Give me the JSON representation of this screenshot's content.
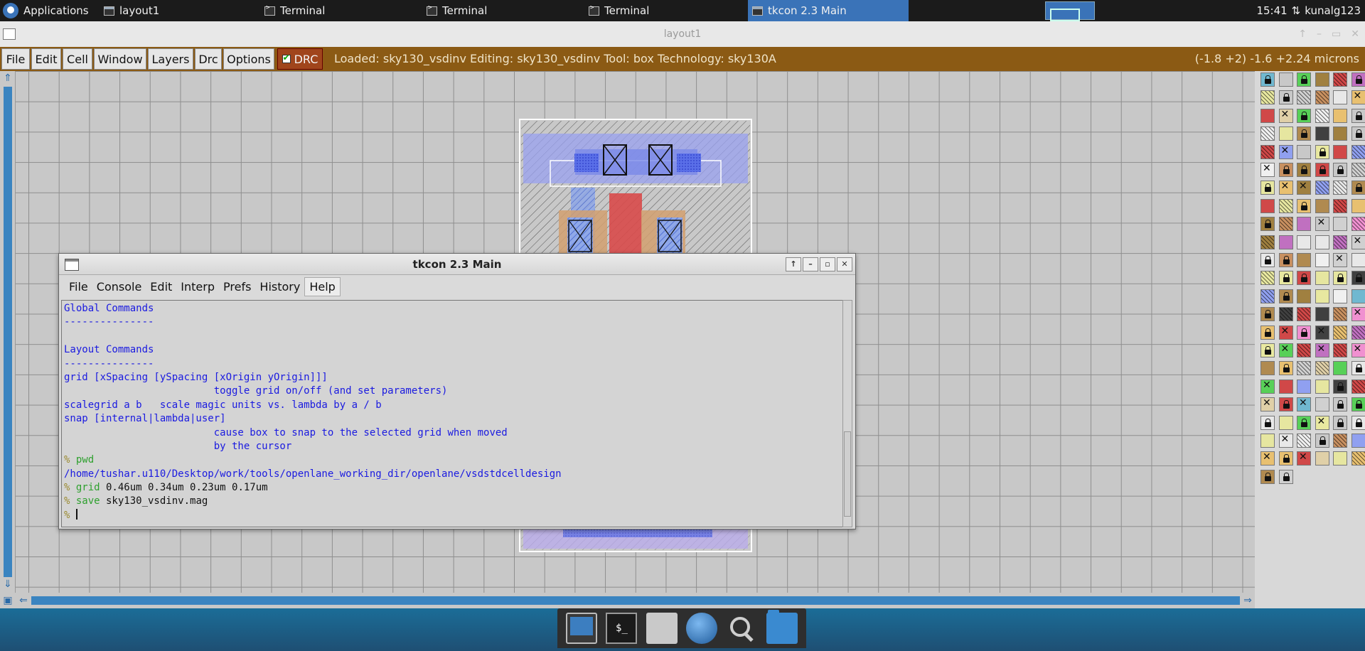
{
  "taskbar": {
    "applications": "Applications",
    "tasks": [
      {
        "label": "layout1"
      },
      {
        "label": "Terminal"
      },
      {
        "label": "Terminal"
      },
      {
        "label": "Terminal"
      },
      {
        "label": "tkcon 2.3 Main"
      }
    ],
    "clock": "15:41",
    "user": "kunalg123"
  },
  "layout_window": {
    "title": "layout1"
  },
  "magic": {
    "menus": [
      "File",
      "Edit",
      "Cell",
      "Window",
      "Layers",
      "Drc",
      "Options"
    ],
    "drc_label": "DRC",
    "status": "Loaded: sky130_vsdinv Editing: sky130_vsdinv Tool: box  Technology: sky130A",
    "coords": "(-1.8 +2) -1.6 +2.24 microns"
  },
  "tkcon": {
    "title": "tkcon 2.3 Main",
    "menus": [
      "File",
      "Console",
      "Edit",
      "Interp",
      "Prefs",
      "History",
      "Help"
    ],
    "lines": [
      {
        "t": "Global Commands",
        "c": "blue"
      },
      {
        "t": "---------------",
        "c": "blue"
      },
      {
        "t": "",
        "c": "blue"
      },
      {
        "t": "Layout Commands",
        "c": "blue"
      },
      {
        "t": "---------------",
        "c": "blue"
      },
      {
        "t": "grid [xSpacing [ySpacing [xOrigin yOrigin]]]",
        "c": "blue"
      },
      {
        "t": "                         toggle grid on/off (and set parameters)",
        "c": "blue"
      },
      {
        "t": "scalegrid a b   scale magic units vs. lambda by a / b",
        "c": "blue"
      },
      {
        "t": "snap [internal|lambda|user]",
        "c": "blue"
      },
      {
        "t": "                         cause box to snap to the selected grid when moved",
        "c": "blue"
      },
      {
        "t": "                         by the cursor",
        "c": "blue"
      },
      {
        "prompt": "% ",
        "cmd": "pwd",
        "args": ""
      },
      {
        "t": "/home/tushar.u110/Desktop/work/tools/openlane_working_dir/openlane/vsdstdcelldesign",
        "c": "blue"
      },
      {
        "prompt": "% ",
        "cmd": "grid",
        "args": " 0.46um 0.34um 0.23um 0.17um"
      },
      {
        "prompt": "% ",
        "cmd": "save",
        "args": " sky130_vsdinv.mag"
      },
      {
        "prompt": "% ",
        "cmd": "",
        "args": "",
        "cursor": true
      }
    ]
  },
  "colors": {
    "magic_bar": "#8b5a14",
    "drc": "#a0451c",
    "console_blue": "#1a1ae0",
    "console_green": "#2ea02e",
    "canvas_bg": "#c8c8c8"
  },
  "icons": {
    "apps": "xfce-logo-icon",
    "dock": [
      "show-desktop-icon",
      "terminal-icon",
      "home-folder-icon",
      "web-browser-icon",
      "search-icon",
      "files-icon"
    ]
  }
}
